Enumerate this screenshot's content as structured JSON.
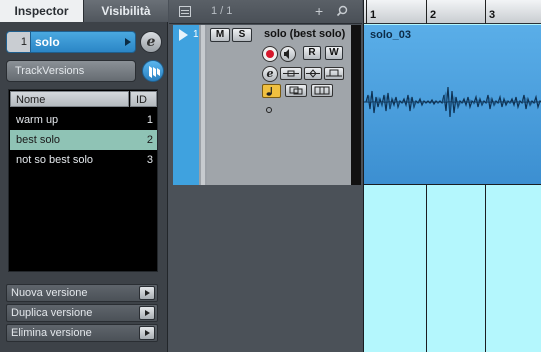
{
  "inspector": {
    "tabs": [
      {
        "label": "Inspector",
        "active": true
      },
      {
        "label": "Visibilità",
        "active": false
      }
    ],
    "track": {
      "number": "1",
      "name": "solo"
    },
    "edit_icon": "e-edit-icon",
    "track_versions_label": "TrackVersions",
    "versions_table": {
      "headers": {
        "name": "Nome",
        "id": "ID"
      },
      "rows": [
        {
          "name": "warm up",
          "id": "1",
          "selected": false
        },
        {
          "name": "best solo",
          "id": "2",
          "selected": true
        },
        {
          "name": "not so best solo",
          "id": "3",
          "selected": false
        }
      ]
    },
    "actions": [
      {
        "label": "Nuova versione"
      },
      {
        "label": "Duplica versione"
      },
      {
        "label": "Elimina versione"
      }
    ]
  },
  "tracklist": {
    "count": "1 / 1",
    "track": {
      "index": "1",
      "mute": "M",
      "solo": "S",
      "name": "solo  (best solo)",
      "read": "R",
      "write": "W",
      "edit": "e"
    }
  },
  "arrange": {
    "bars": [
      "1",
      "2",
      "3"
    ],
    "event_name": "solo_03"
  },
  "colors": {
    "track_color": "#3fa2df",
    "selected_version": "#8fc3b5",
    "arrange_bg": "#b4f7fd",
    "record": "#d6182c"
  }
}
